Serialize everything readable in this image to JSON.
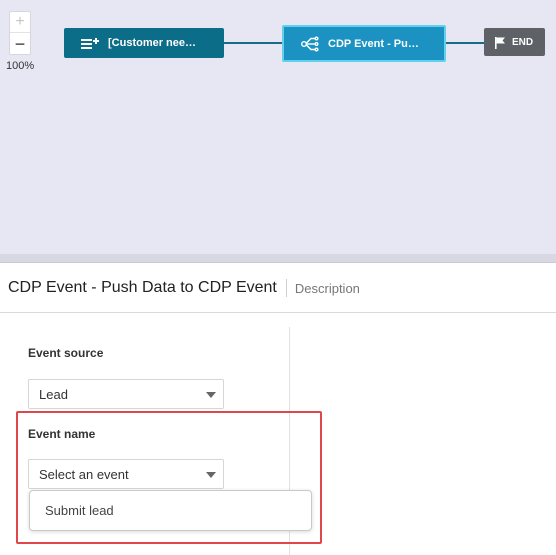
{
  "canvas": {
    "zoom": {
      "zoom_in_label": "+",
      "zoom_out_label": "−",
      "level": "100%"
    },
    "nodes": {
      "customer": {
        "label": "[Customer nee…",
        "icon": "list-add-icon"
      },
      "cdp": {
        "label": "CDP Event - Pu…",
        "icon": "share-fork-icon"
      },
      "end": {
        "label": "END",
        "icon": "flag-icon"
      }
    },
    "colors": {
      "customer_node": "#0c6d88",
      "cdp_node": "#1b92c1",
      "cdp_selected_border": "#5fd0ee",
      "end_node": "#5e6266",
      "connector": "#1a6c86",
      "canvas_bg": "#e6e7f2"
    }
  },
  "panel": {
    "title": "CDP Event - Push Data to CDP Event",
    "description_link": "Description",
    "event_source": {
      "label": "Event source",
      "value": "Lead"
    },
    "event_name": {
      "label": "Event name",
      "placeholder": "Select an event",
      "options": [
        "Submit lead"
      ]
    },
    "highlight_color": "#e0474c"
  }
}
